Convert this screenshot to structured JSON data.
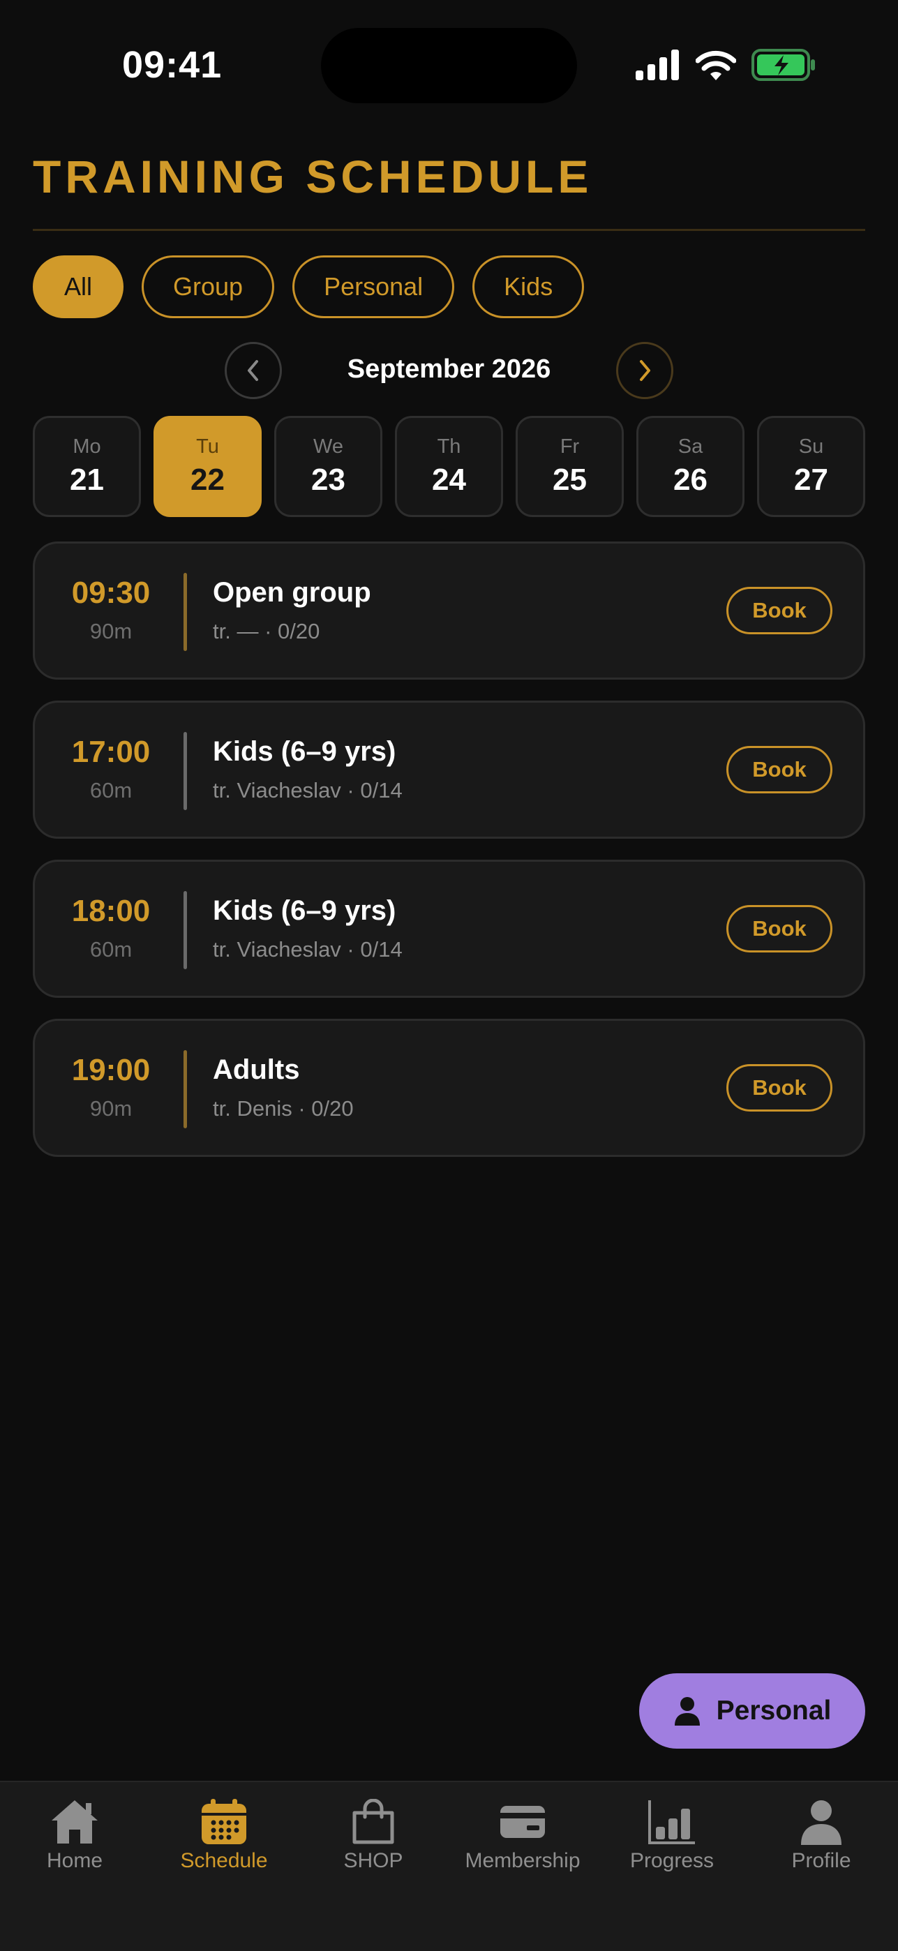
{
  "status_bar": {
    "time": "09:41"
  },
  "header": {
    "title": "TRAINING SCHEDULE"
  },
  "filters": [
    {
      "label": "All",
      "active": true
    },
    {
      "label": "Group",
      "active": false
    },
    {
      "label": "Personal",
      "active": false
    },
    {
      "label": "Kids",
      "active": false
    }
  ],
  "month_nav": {
    "label": "September 2026"
  },
  "days": [
    {
      "name": "Mo",
      "num": "21",
      "active": false
    },
    {
      "name": "Tu",
      "num": "22",
      "active": true
    },
    {
      "name": "We",
      "num": "23",
      "active": false
    },
    {
      "name": "Th",
      "num": "24",
      "active": false
    },
    {
      "name": "Fr",
      "num": "25",
      "active": false
    },
    {
      "name": "Sa",
      "num": "26",
      "active": false
    },
    {
      "name": "Su",
      "num": "27",
      "active": false
    }
  ],
  "sessions": [
    {
      "time": "09:30",
      "duration": "90m",
      "title": "Open group",
      "subtitle": "tr. — · 0/20",
      "button": "Book"
    },
    {
      "time": "17:00",
      "duration": "60m",
      "title": "Kids (6–9 yrs)",
      "subtitle": "tr. Viacheslav · 0/14",
      "button": "Book"
    },
    {
      "time": "18:00",
      "duration": "60m",
      "title": "Kids (6–9 yrs)",
      "subtitle": "tr. Viacheslav · 0/14",
      "button": "Book"
    },
    {
      "time": "19:00",
      "duration": "90m",
      "title": "Adults",
      "subtitle": "tr. Denis · 0/20",
      "button": "Book"
    }
  ],
  "fab": {
    "label": "Personal",
    "icon": "person-icon"
  },
  "tabs": [
    {
      "label": "Home",
      "icon": "home-icon",
      "active": false
    },
    {
      "label": "Schedule",
      "icon": "calendar-icon",
      "active": true
    },
    {
      "label": "SHOP",
      "icon": "shopping-bag-icon",
      "active": false
    },
    {
      "label": "Membership",
      "icon": "card-icon",
      "active": false
    },
    {
      "label": "Progress",
      "icon": "bar-chart-icon",
      "active": false
    },
    {
      "label": "Profile",
      "icon": "person-icon",
      "active": false
    }
  ],
  "colors": {
    "accent": "#d19a2a",
    "fab": "#a07ee0",
    "background": "#0d0d0d",
    "card": "#191919",
    "battery": "#35c75a"
  }
}
